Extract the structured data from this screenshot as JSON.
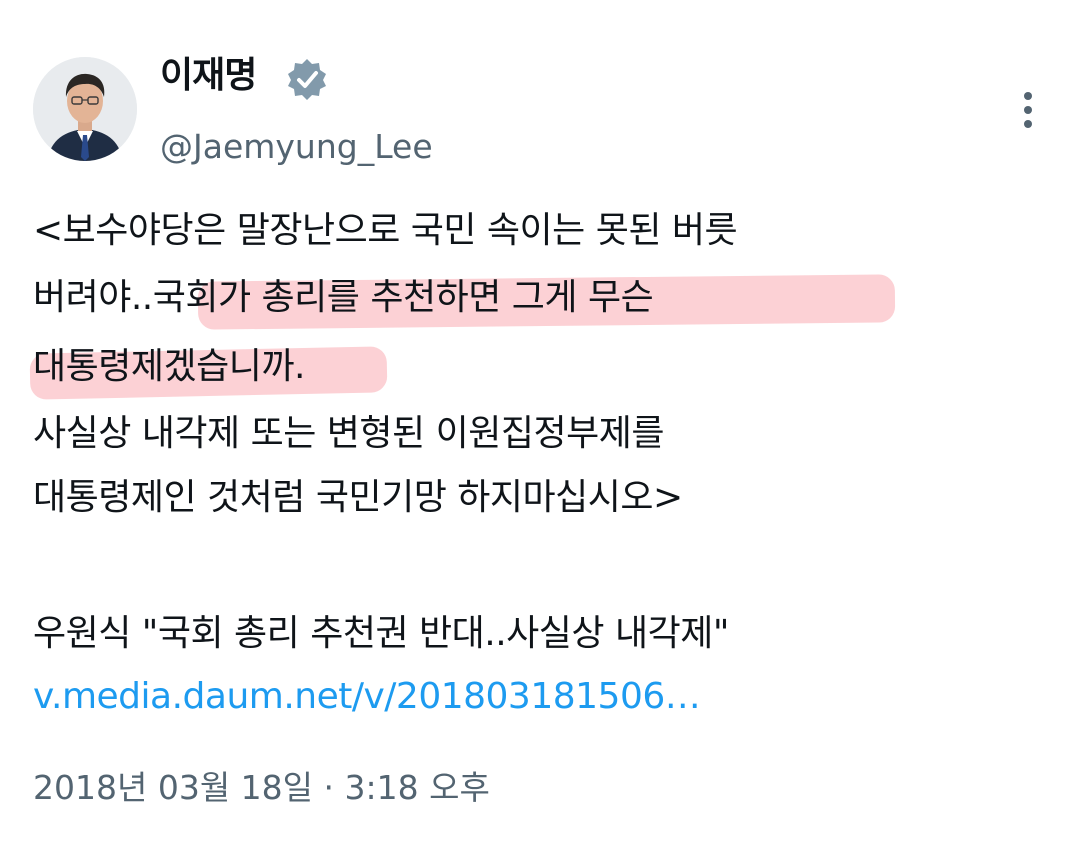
{
  "author": {
    "name": "이재명",
    "handle": "@Jaemyung_Lee",
    "avatar_icon": "portrait-avatar",
    "verified_icon": "verified-badge-icon",
    "verified_color": "#829aab"
  },
  "tweet": {
    "text_lines": [
      {
        "prefix": "<보수야당은 말장난으로 국민 속이는 못된 버릇",
        "highlight": ""
      },
      {
        "prefix": "버려야..",
        "highlight": "국회가 총리를 추천하면 그게 무슨"
      },
      {
        "prefix": "대통령제겠습니까.",
        "highlight": ""
      },
      {
        "prefix": "사실상 내각제 또는 변형된 이원집정부제를",
        "highlight": ""
      },
      {
        "prefix": "대통령제인 것처럼 국민기망 하지마십시오>",
        "highlight": ""
      }
    ],
    "quote": "우원식 \"국회 총리 추천권 반대..사실상 내각제\"",
    "link": "v.media.daum.net/v/201803181506…",
    "link_color": "#1d9bf0",
    "highlight_color": "#f67a88"
  },
  "timestamp": "2018년 03월 18일 · 3:18 오후",
  "more_icon": "more-vertical-icon"
}
